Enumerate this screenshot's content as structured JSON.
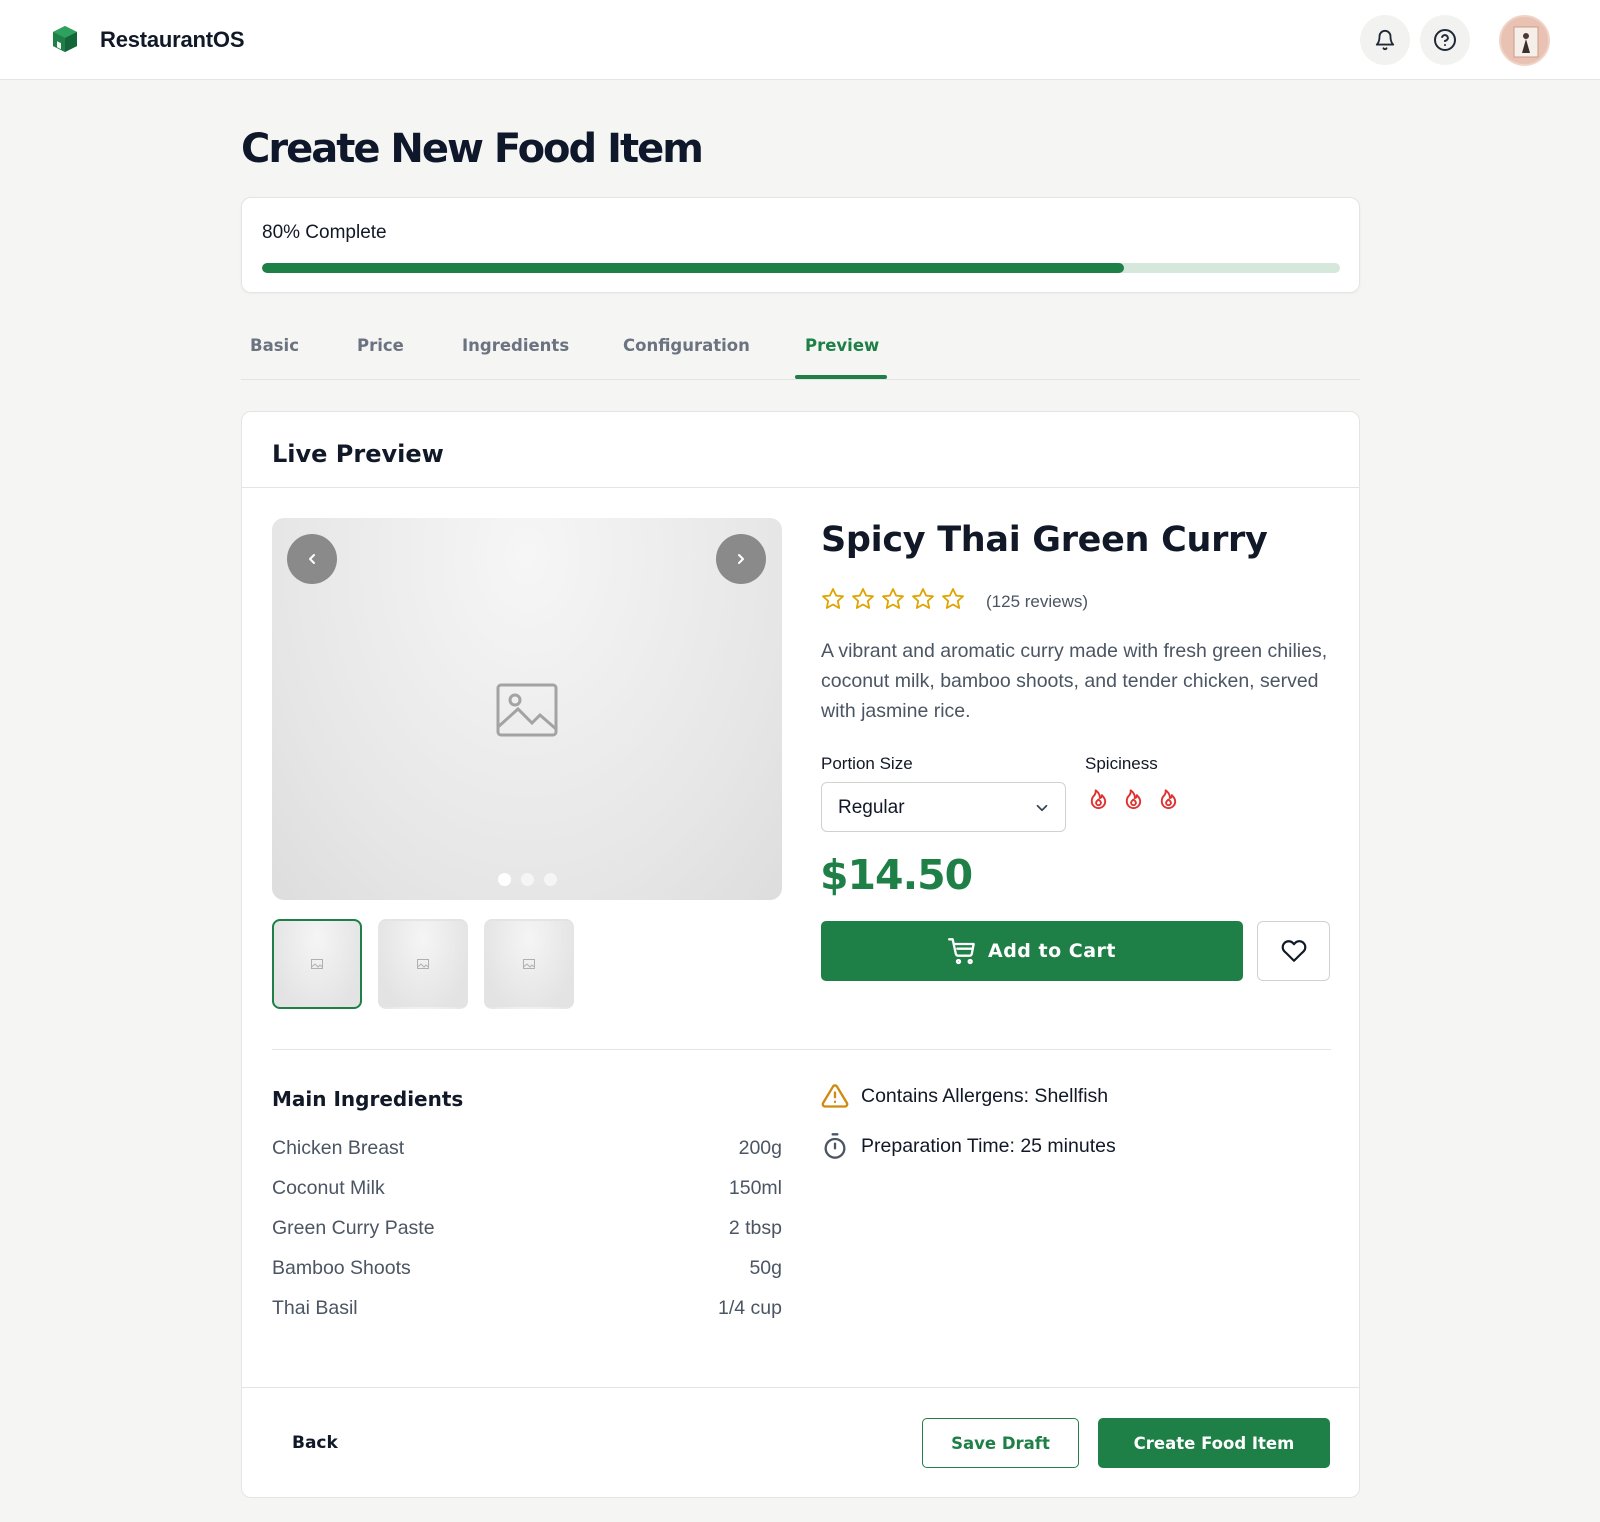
{
  "app": {
    "brand": "RestaurantOS"
  },
  "header": {
    "icons": [
      "bell-icon",
      "help-icon"
    ],
    "avatar": "user-avatar"
  },
  "page": {
    "title": "Create New Food Item"
  },
  "progress": {
    "label": "80% Complete",
    "fraction": 0.8
  },
  "tabs": [
    {
      "label": "Basic",
      "active": false
    },
    {
      "label": "Price",
      "active": false
    },
    {
      "label": "Ingredients",
      "active": false
    },
    {
      "label": "Configuration",
      "active": false
    },
    {
      "label": "Preview",
      "active": true
    }
  ],
  "preview": {
    "title": "Live Preview",
    "gallery": {
      "image_count": 3,
      "selected": 0
    },
    "item": {
      "name": "Spicy Thai Green Curry",
      "rating": 5,
      "reviews": "(125 reviews)",
      "description": "A vibrant and aromatic curry made with fresh green chilies, coconut milk, bamboo shoots, and tender chicken, served with jasmine rice.",
      "portion_label": "Portion Size",
      "portion_value": "Regular",
      "spiciness_label": "Spiciness",
      "spiciness_level": 3,
      "price": "$14.50",
      "add_to_cart": "Add to Cart"
    },
    "ingredients": {
      "title": "Main Ingredients",
      "items": [
        {
          "name": "Chicken Breast",
          "qty": "200g"
        },
        {
          "name": "Coconut Milk",
          "qty": "150ml"
        },
        {
          "name": "Green Curry Paste",
          "qty": "2 tbsp"
        },
        {
          "name": "Bamboo Shoots",
          "qty": "50g"
        },
        {
          "name": "Thai Basil",
          "qty": "1/4 cup"
        }
      ]
    },
    "info": {
      "allergens": "Contains Allergens: Shellfish",
      "prep_time": "Preparation Time: 25 minutes"
    }
  },
  "footer": {
    "back": "Back",
    "save_draft": "Save Draft",
    "create": "Create Food Item"
  },
  "colors": {
    "primary": "#1e7f47",
    "star": "#e0a400",
    "flame": "#e03131",
    "warning": "#d08a0e"
  }
}
